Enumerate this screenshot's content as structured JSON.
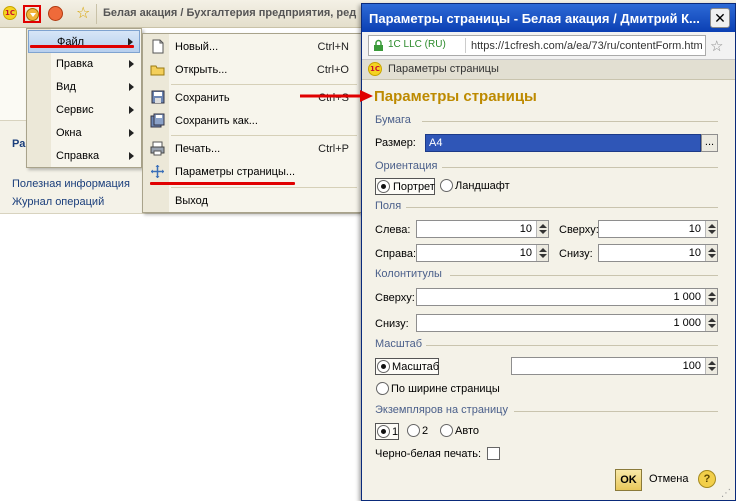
{
  "bg_app": {
    "title": "Белая акация / Бухгалтерия предприятия, ред",
    "logo": "1С",
    "sidebar_letter": "Ра",
    "links": [
      "Полезная информация",
      "Журнал операций"
    ]
  },
  "main_menu": {
    "items": [
      {
        "label": "Файл",
        "active": true
      },
      {
        "label": "Правка"
      },
      {
        "label": "Вид"
      },
      {
        "label": "Сервис"
      },
      {
        "label": "Окна"
      },
      {
        "label": "Справка"
      }
    ]
  },
  "file_menu": {
    "items": [
      {
        "label": "Новый...",
        "shortcut": "Ctrl+N",
        "icon": "new-document-icon"
      },
      {
        "label": "Открыть...",
        "shortcut": "Ctrl+O",
        "icon": "open-folder-icon"
      },
      {
        "label": "Сохранить",
        "shortcut": "Ctrl+S",
        "icon": "save-icon"
      },
      {
        "label": "Сохранить как...",
        "shortcut": "",
        "icon": "save-as-icon"
      },
      {
        "label": "Печать...",
        "shortcut": "Ctrl+P",
        "icon": "printer-icon"
      },
      {
        "label": "Параметры страницы...",
        "shortcut": "",
        "icon": "page-setup-icon"
      },
      {
        "label": "Выход",
        "shortcut": "",
        "icon": ""
      }
    ]
  },
  "dialog": {
    "title": "Параметры страницы - Белая акация / Дмитрий К...",
    "url_org": "1C LLC (RU)",
    "url": "https://1cfresh.com/a/ea/73/ru/contentForm.htm",
    "subbar": "Параметры страницы",
    "heading": "Параметры страницы",
    "paper": {
      "section": "Бумага",
      "size_label": "Размер:",
      "size_value": "A4",
      "browse": "..."
    },
    "orientation": {
      "section": "Ориентация",
      "portrait": "Портрет",
      "landscape": "Ландшафт",
      "selected": "Портрет"
    },
    "margins": {
      "section": "Поля",
      "left_label": "Слева:",
      "left": "10",
      "top_label": "Сверху:",
      "top": "10",
      "right_label": "Справа:",
      "right": "10",
      "bottom_label": "Снизу:",
      "bottom": "10"
    },
    "headers": {
      "section": "Колонтитулы",
      "header_label": "Сверху:",
      "header": "1 000",
      "footer_label": "Снизу:",
      "footer": "1 000"
    },
    "scale": {
      "section": "Масштаб",
      "scale_label": "Масштаб",
      "scale_value": "100",
      "fit_width_label": "По ширине страницы",
      "selected": "Масштаб"
    },
    "copies": {
      "section": "Экземпляров на страницу",
      "opt1": "1",
      "opt2": "2",
      "opt_auto": "Авто",
      "selected": "1"
    },
    "bw_print": {
      "label": "Черно-белая печать:",
      "checked": false
    },
    "ok": "OK",
    "cancel": "Отмена",
    "help": "?"
  },
  "colors": {
    "annotation": "#e00000",
    "heading": "#bd8a00",
    "title_bar": "#0b3fb3"
  }
}
